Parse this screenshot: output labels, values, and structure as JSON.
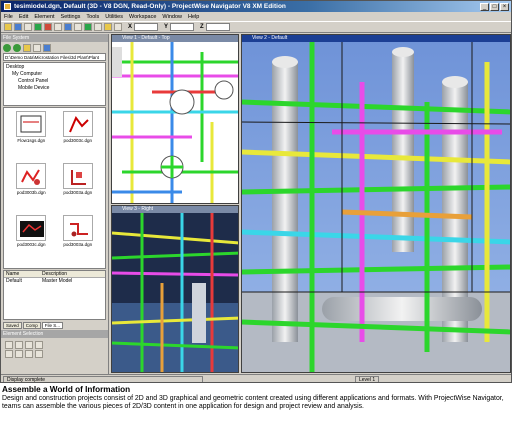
{
  "window": {
    "title": "tesimiodel.dgn, Default (3D - V8 DGN, Read-Only) - ProjectWise Navigator V8 XM Edition",
    "min": "_",
    "max": "□",
    "close": "×"
  },
  "menu": [
    "File",
    "Edit",
    "Element",
    "Settings",
    "Tools",
    "Utilities",
    "Workspace",
    "Window",
    "Help"
  ],
  "coords": [
    "X",
    "Y",
    "Z"
  ],
  "left": {
    "panel_title": "File System",
    "path": "D:\\Demo Data\\Microstation Files\\3d Plant\\Plant",
    "tree": [
      "Desktop",
      "My Computer",
      "Control Panel",
      "Mobile Device"
    ],
    "thumbs": [
      "Flow1sgs.dgn",
      "pod3003c.dgn",
      "pod3003b.dgn",
      "pod3003a.dgn",
      "pod3003c.dgn",
      "pod3003a.dgn"
    ],
    "prop_headers": [
      "Name",
      "Description"
    ],
    "prop_rows": [
      [
        "Default",
        "Master Model"
      ]
    ],
    "tabs": [
      "Saved",
      "Comp",
      "File S..."
    ],
    "element_title": "Element Selection"
  },
  "views": {
    "v1": "View 1 - Default - Top",
    "v3": "View 3 - Right",
    "v2": "View 2 - Default"
  },
  "status": {
    "message": "Display complete",
    "level": "Level 1"
  },
  "caption": {
    "heading": "Assemble a World of Information",
    "body": "Design and construction projects consist of 2D and 3D graphical and geometric content created using different applications and formats. With ProjectWise Navigator, teams can assemble the various pieces of 2D/3D content in one application for design and project review and analysis."
  }
}
